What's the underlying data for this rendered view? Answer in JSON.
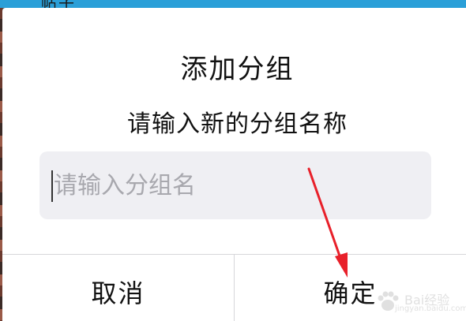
{
  "backdrop": {
    "peek_text": "帖子"
  },
  "dialog": {
    "title": "添加分组",
    "message": "请输入新的分组名称",
    "input": {
      "value": "",
      "placeholder": "请输入分组名"
    },
    "buttons": {
      "cancel_label": "取消",
      "confirm_label": "确定"
    }
  },
  "watermark": {
    "brand": "Bai经验",
    "url": "jingyan.baidu.com"
  },
  "colors": {
    "dialog_bg": "#ffffff",
    "input_bg": "#efeff3",
    "divider": "#d6d6da",
    "annotation_arrow": "#e8202a",
    "backdrop_top": "#2a9fd8"
  },
  "icons": {
    "watermark_logo": "baidu-paw-icon"
  }
}
